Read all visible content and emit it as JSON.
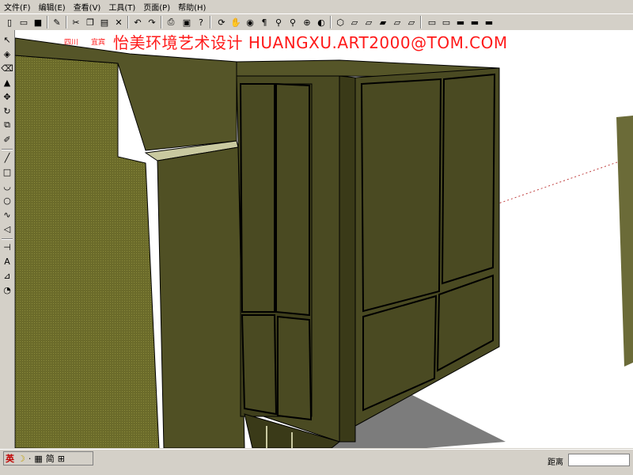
{
  "menu": [
    "文件(F)",
    "编辑(E)",
    "查看(V)",
    "工具(T)",
    "页面(P)",
    "帮助(H)"
  ],
  "watermark": {
    "small1": "四川",
    "small2": "宜宾",
    "main": "怡美环境艺术设计  HUANGXU.ART2000@TOM.COM",
    "color": "#ff1a1a"
  },
  "toolbar_icons": [
    "new-file-icon",
    "open-file-icon",
    "save-icon",
    "paint-icon",
    "cut-icon",
    "copy-icon",
    "paste-icon",
    "delete-icon",
    "undo-icon",
    "redo-icon",
    "print-icon",
    "model-info-icon",
    "whats-this-icon",
    "orbit-icon",
    "pan-icon",
    "walk-icon",
    "look-around-icon",
    "zoom-icon",
    "zoom-window-icon",
    "zoom-extents-icon",
    "previous-view-icon",
    "iso-view-icon",
    "top-view-icon",
    "front-view-icon",
    "right-view-icon",
    "back-view-icon",
    "left-view-icon",
    "wireframe-icon",
    "hidden-line-icon",
    "shaded-icon",
    "shaded-texture-icon",
    "xray-icon"
  ],
  "left_tool_icons": [
    "select-icon",
    "paint-bucket-icon",
    "eraser-icon",
    "push-pull-icon",
    "move-icon",
    "rotate-icon",
    "scale-icon",
    "offset-icon",
    "line-icon",
    "rectangle-icon",
    "arc-icon",
    "circle-icon",
    "freehand-icon",
    "polygon-icon",
    "tape-measure-icon",
    "text-icon",
    "dimension-icon",
    "protractor-icon"
  ],
  "status": {
    "ime_mode": "英",
    "ime_moon": "☽",
    "ime_dot": "·",
    "ime_kbd": "▦",
    "ime_simplified": "简",
    "ime_extra": "⊞",
    "distance_label": "距离",
    "distance_value": ""
  },
  "colors": {
    "panel_olive": "#4a4a22",
    "panel_dark": "#3a3a18",
    "fabric": "#6b6b2a",
    "ledge": "#c9c9a0",
    "chrome": "#d4d0c8"
  }
}
